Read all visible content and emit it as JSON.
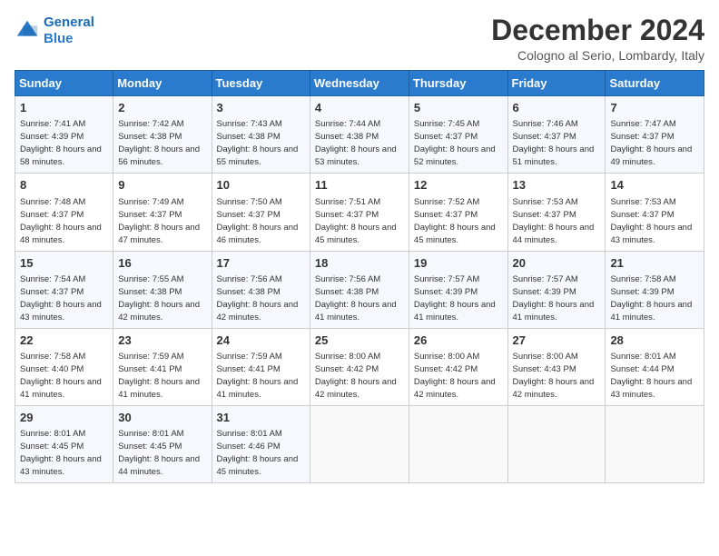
{
  "header": {
    "logo_line1": "General",
    "logo_line2": "Blue",
    "title": "December 2024",
    "subtitle": "Cologno al Serio, Lombardy, Italy"
  },
  "days_of_week": [
    "Sunday",
    "Monday",
    "Tuesday",
    "Wednesday",
    "Thursday",
    "Friday",
    "Saturday"
  ],
  "weeks": [
    [
      {
        "day": "1",
        "sunrise": "7:41 AM",
        "sunset": "4:39 PM",
        "daylight": "8 hours and 58 minutes."
      },
      {
        "day": "2",
        "sunrise": "7:42 AM",
        "sunset": "4:38 PM",
        "daylight": "8 hours and 56 minutes."
      },
      {
        "day": "3",
        "sunrise": "7:43 AM",
        "sunset": "4:38 PM",
        "daylight": "8 hours and 55 minutes."
      },
      {
        "day": "4",
        "sunrise": "7:44 AM",
        "sunset": "4:38 PM",
        "daylight": "8 hours and 53 minutes."
      },
      {
        "day": "5",
        "sunrise": "7:45 AM",
        "sunset": "4:37 PM",
        "daylight": "8 hours and 52 minutes."
      },
      {
        "day": "6",
        "sunrise": "7:46 AM",
        "sunset": "4:37 PM",
        "daylight": "8 hours and 51 minutes."
      },
      {
        "day": "7",
        "sunrise": "7:47 AM",
        "sunset": "4:37 PM",
        "daylight": "8 hours and 49 minutes."
      }
    ],
    [
      {
        "day": "8",
        "sunrise": "7:48 AM",
        "sunset": "4:37 PM",
        "daylight": "8 hours and 48 minutes."
      },
      {
        "day": "9",
        "sunrise": "7:49 AM",
        "sunset": "4:37 PM",
        "daylight": "8 hours and 47 minutes."
      },
      {
        "day": "10",
        "sunrise": "7:50 AM",
        "sunset": "4:37 PM",
        "daylight": "8 hours and 46 minutes."
      },
      {
        "day": "11",
        "sunrise": "7:51 AM",
        "sunset": "4:37 PM",
        "daylight": "8 hours and 45 minutes."
      },
      {
        "day": "12",
        "sunrise": "7:52 AM",
        "sunset": "4:37 PM",
        "daylight": "8 hours and 45 minutes."
      },
      {
        "day": "13",
        "sunrise": "7:53 AM",
        "sunset": "4:37 PM",
        "daylight": "8 hours and 44 minutes."
      },
      {
        "day": "14",
        "sunrise": "7:53 AM",
        "sunset": "4:37 PM",
        "daylight": "8 hours and 43 minutes."
      }
    ],
    [
      {
        "day": "15",
        "sunrise": "7:54 AM",
        "sunset": "4:37 PM",
        "daylight": "8 hours and 43 minutes."
      },
      {
        "day": "16",
        "sunrise": "7:55 AM",
        "sunset": "4:38 PM",
        "daylight": "8 hours and 42 minutes."
      },
      {
        "day": "17",
        "sunrise": "7:56 AM",
        "sunset": "4:38 PM",
        "daylight": "8 hours and 42 minutes."
      },
      {
        "day": "18",
        "sunrise": "7:56 AM",
        "sunset": "4:38 PM",
        "daylight": "8 hours and 41 minutes."
      },
      {
        "day": "19",
        "sunrise": "7:57 AM",
        "sunset": "4:39 PM",
        "daylight": "8 hours and 41 minutes."
      },
      {
        "day": "20",
        "sunrise": "7:57 AM",
        "sunset": "4:39 PM",
        "daylight": "8 hours and 41 minutes."
      },
      {
        "day": "21",
        "sunrise": "7:58 AM",
        "sunset": "4:39 PM",
        "daylight": "8 hours and 41 minutes."
      }
    ],
    [
      {
        "day": "22",
        "sunrise": "7:58 AM",
        "sunset": "4:40 PM",
        "daylight": "8 hours and 41 minutes."
      },
      {
        "day": "23",
        "sunrise": "7:59 AM",
        "sunset": "4:41 PM",
        "daylight": "8 hours and 41 minutes."
      },
      {
        "day": "24",
        "sunrise": "7:59 AM",
        "sunset": "4:41 PM",
        "daylight": "8 hours and 41 minutes."
      },
      {
        "day": "25",
        "sunrise": "8:00 AM",
        "sunset": "4:42 PM",
        "daylight": "8 hours and 42 minutes."
      },
      {
        "day": "26",
        "sunrise": "8:00 AM",
        "sunset": "4:42 PM",
        "daylight": "8 hours and 42 minutes."
      },
      {
        "day": "27",
        "sunrise": "8:00 AM",
        "sunset": "4:43 PM",
        "daylight": "8 hours and 42 minutes."
      },
      {
        "day": "28",
        "sunrise": "8:01 AM",
        "sunset": "4:44 PM",
        "daylight": "8 hours and 43 minutes."
      }
    ],
    [
      {
        "day": "29",
        "sunrise": "8:01 AM",
        "sunset": "4:45 PM",
        "daylight": "8 hours and 43 minutes."
      },
      {
        "day": "30",
        "sunrise": "8:01 AM",
        "sunset": "4:45 PM",
        "daylight": "8 hours and 44 minutes."
      },
      {
        "day": "31",
        "sunrise": "8:01 AM",
        "sunset": "4:46 PM",
        "daylight": "8 hours and 45 minutes."
      },
      null,
      null,
      null,
      null
    ]
  ]
}
